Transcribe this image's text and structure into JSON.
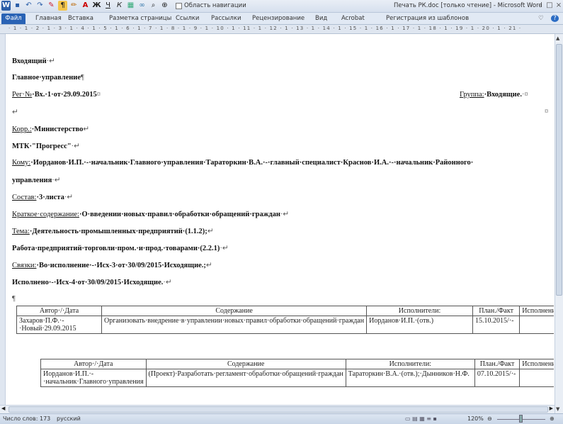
{
  "titlebar": {
    "title": "Печать РК.doc [только чтение] - Microsoft Word",
    "qat_icons": [
      "word-icon",
      "save-icon",
      "undo-icon",
      "redo-icon",
      "format-icon",
      "paragraph-mark-icon",
      "highlight-icon",
      "font-color-icon",
      "bold-icon",
      "underline-icon",
      "italic-icon",
      "image-icon",
      "link-icon",
      "binoculars-icon",
      "zoom-icon"
    ],
    "nav_pane_label": "Область навигации"
  },
  "ribbon": {
    "file": "Файл",
    "tabs": [
      "Главная",
      "Вставка",
      "Разметка страницы",
      "Ссылки",
      "Рассылки",
      "Рецензирование",
      "Вид",
      "Acrobat",
      "Регистрация из шаблонов"
    ]
  },
  "ruler": {
    "text": "· 1 · 1 · 2 · 1 · 3 · 1 · 4 · 1 · 5 · 1 · 6 · 1 · 7 · 1 · 8 · 1 · 9 · 1 · 10 · 1 · 11 · 1 · 12 · 1 · 13 · 1 · 14 · 1 · 15 · 1 · 16 · 1 · 17 · 1 · 18 · 1 · 19 · 1 · 20 · 1 · 21 ·"
  },
  "doc": {
    "incoming": "Входящий",
    "dept": "Главное·управление",
    "reg_label": "Рег·№",
    "reg_value": "·Вх.·1·от·29.09.2015",
    "group_label": "Группа:",
    "group_value": "·Входящие.",
    "corr_label": "Корр.:",
    "corr_value": "·Министерство",
    "corr_value2": "МТК·\"Прогресс\"",
    "to_label": "Кому:",
    "to_value": "·Иорданов·И.П.·-·начальник·Главного·управления·Тараторкин·В.А.·-·главный·специалист·Краснов·И.А.·-·начальник·Районного·",
    "to_value2": "управления",
    "comp_label": "Состав:",
    "comp_value": "·3·листа",
    "summary_label": "Краткое·содержание:",
    "summary_value": "·О·введении·новых·правил·обработки·обращений·граждан",
    "topic_label": "Тема:",
    "topic_value": "·Деятельность·промышленных·предприятий·(1.1.2);",
    "topic_value2": "Работа·предприятий·торговли·пром.·и·прод.·товарами·(2.2.1)",
    "links_label": "Связки:",
    "links_value": "·Во·исполнение·-·Исх-3·от·30/09/2015·Исходящие.;",
    "done_value": "Исполнено·-·Исх-4·от·30/09/2015·Исходящие."
  },
  "table1": {
    "headers": [
      "Автор·/·Дата",
      "Содержание",
      "Исполнители:",
      "План./Факт",
      "Исполнение"
    ],
    "rows": [
      [
        "Захаров·П.Ф.·-·Новый·29.09.2015",
        "Организовать·внедрение·в·управлении·новых·правил·обработки·обращений·граждан",
        "Иорданов·И.П.·(отв.)",
        "15.10.2015/·-",
        ""
      ]
    ]
  },
  "table2": {
    "headers": [
      "Автор·/·Дата",
      "Содержание",
      "Исполнители:",
      "План./Факт",
      "Исполнение"
    ],
    "rows": [
      [
        "Иорданов·И.П.·-·начальник·Главного·управления",
        "(Проект)·Разработать·регламент·обработки·обращений·граждан",
        "Тараторкин·В.А.·(отв.);·Дынников·Н.Ф.",
        "07.10.2015/·-",
        ""
      ]
    ]
  },
  "status": {
    "words": "Число слов: 173",
    "lang": "русский",
    "zoom": "120%"
  }
}
